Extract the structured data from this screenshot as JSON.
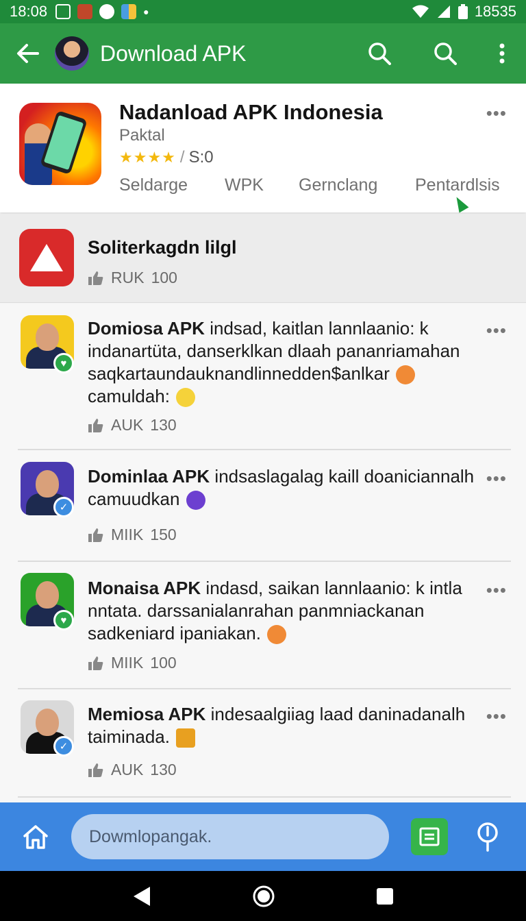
{
  "status_bar": {
    "time": "18:08",
    "battery": "18535"
  },
  "app_bar": {
    "title": "Download APK"
  },
  "app_card": {
    "title": "Nadanload APK Indonesia",
    "developer": "Paktal",
    "stars": "★★★★",
    "rating_sep": "/",
    "rating": "S:0",
    "tabs": [
      "Seldarge",
      "WPK",
      "Gernclang",
      "Pentardlsis"
    ],
    "more": "•••"
  },
  "featured": {
    "title": "Soliterkagdn lilgl",
    "meta_label": "RUK",
    "meta_count": "100"
  },
  "comments": [
    {
      "author": "Domiosa APK",
      "text": "indsad, kaitlan lannlaanio: k indanartüta, danserklkan dlaah pananriamahan saqkartaundauknandlinnedden$anlkar",
      "text2": "camuldah:",
      "meta_label": "AUK",
      "meta_count": "130",
      "badge": "heart",
      "badge_color": "#2ca84a",
      "bg": "#f4c91e",
      "emoji1_color": "#f08a36",
      "emoji2_color": "#f5d23a"
    },
    {
      "author": "Dominlaa APK",
      "text": "indsaslagalag kaill doaniciannalh camuudkan",
      "meta_label": "MIIK",
      "meta_count": "150",
      "badge": "check",
      "badge_color": "#3d8de0",
      "bg": "#4a3ab0",
      "emoji1_color": "#6c3fd0"
    },
    {
      "author": "Monaisa APK",
      "text": "indasd, saikan lannlaanio: k intla nntata. darssanialanrahan panmniackanan sadkeniard ipaniakan.",
      "meta_label": "MIIK",
      "meta_count": "100",
      "badge": "heart",
      "badge_color": "#2ca84a",
      "bg": "#2aa22a",
      "emoji1_color": "#f08a36"
    },
    {
      "author": "Memiosa APK",
      "text": "indesaalgiiag laad daninadanalh taiminada.",
      "meta_label": "AUK",
      "meta_count": "130",
      "badge": "check",
      "badge_color": "#3d8de0",
      "bg": "#d9d9d9",
      "emoji1_color": "#e8a020"
    }
  ],
  "comment_more": "•••",
  "bottom_bar": {
    "search_placeholder": "Dowmlopangak."
  },
  "icons": {
    "back": "arrow-left-icon",
    "search": "search-icon",
    "more": "more-vert-icon",
    "like": "thumbs-up-icon",
    "home": "home-icon",
    "list": "list-icon",
    "mic": "mic-icon"
  },
  "colors": {
    "status_bar": "#1f8a3a",
    "app_bar": "#2e9a46",
    "bottom_bar": "#3c86e0",
    "star": "#f3b80e",
    "search_pill": "#b7d1f1"
  }
}
